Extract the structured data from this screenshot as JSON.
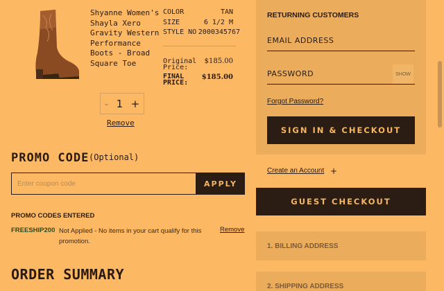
{
  "cart": {
    "product_name": "Shyanne Women's Shayla Xero Gravity Western Performance Boots - Broad Square Toe",
    "specs": [
      {
        "label": "COLOR",
        "value": "TAN"
      },
      {
        "label": "SIZE",
        "value": "6 1/2 M"
      },
      {
        "label": "STYLE NO",
        "value": "2000345767"
      }
    ],
    "original_price_label": "Original Price:",
    "original_price": "$185.00",
    "final_price_label": "FINAL PRICE:",
    "final_price": "$185.00",
    "quantity": "1",
    "qty_minus": "-",
    "qty_plus": "+",
    "remove_label": "Remove"
  },
  "promo": {
    "title": "PROMO CODE",
    "optional": "(Optional)",
    "placeholder": "Enter coupon code",
    "apply_label": "APPLY",
    "entered_title": "PROMO CODES ENTERED",
    "code": "FREESHIP200",
    "message": "Not Applied - No items in your cart qualify for this promotion.",
    "remove_label": "Remove"
  },
  "order_summary_title": "ORDER SUMMARY",
  "returning": {
    "title": "RETURNING CUSTOMERS",
    "email_placeholder": "EMAIL ADDRESS",
    "password_placeholder": "PASSWORD",
    "show_label": "SHOW",
    "forgot_label": "Forgot Password?",
    "signin_label": "SIGN IN & CHECKOUT"
  },
  "create_account_label": "Create an Account",
  "create_account_icon": "plus-icon",
  "guest_checkout_label": "GUEST CHECKOUT",
  "steps": [
    "1. BILLING ADDRESS",
    "2. SHIPPING ADDRESS"
  ],
  "colors": {
    "background": "#fdb863",
    "panel": "#ebad5c",
    "dark_button": "#2b1d14",
    "button_text": "#f5b662"
  }
}
